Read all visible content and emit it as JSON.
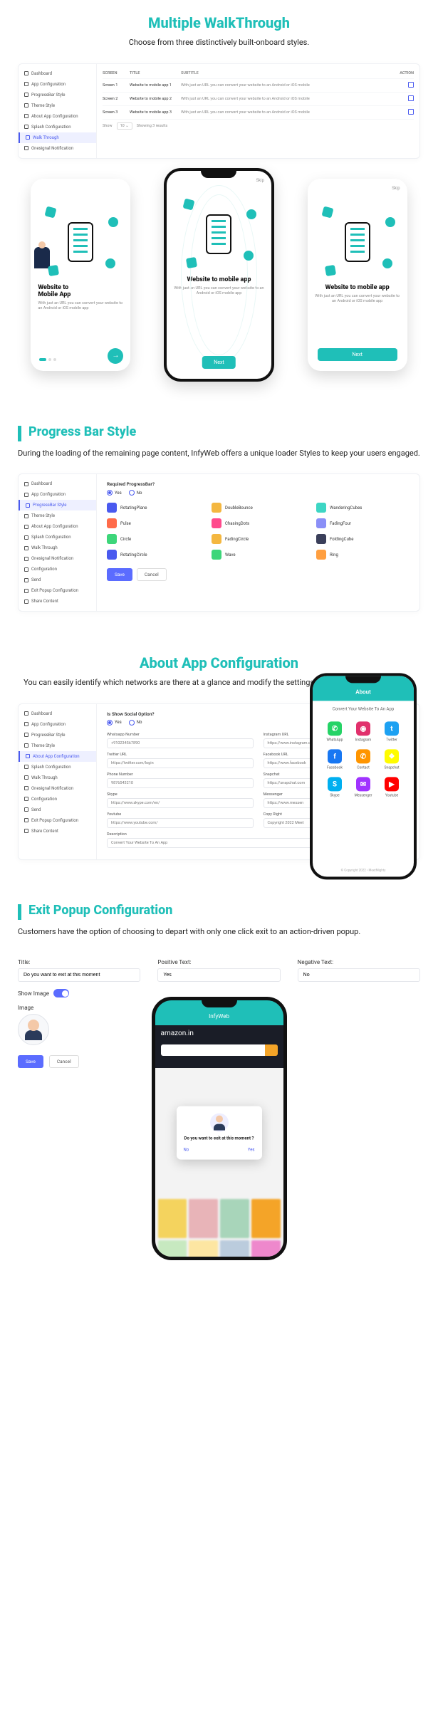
{
  "s1": {
    "title": "Multiple WalkThrough",
    "subtitle": "Choose from three distinctively built-onboard styles.",
    "sidebar": [
      "Dashboard",
      "App Configuration",
      "ProgressBar Style",
      "Theme Style",
      "About App Configuration",
      "Splash Configuration",
      "Walk Through",
      "Onesignal Notification"
    ],
    "activeIdx": 6,
    "thead": {
      "screen": "SCREEN",
      "title": "TITLE",
      "subtitle": "SUBTITLE",
      "action": "ACTION"
    },
    "rows": [
      {
        "screen": "Screen 1",
        "title": "Website to mobile app 1",
        "sub": "With just an URL you can convert your website to an Android or iOS mobile"
      },
      {
        "screen": "Screen 2",
        "title": "Website to mobile app 2",
        "sub": "With just an URL you can convert your website to an Android or iOS mobile"
      },
      {
        "screen": "Screen 3",
        "title": "Website to mobile app 3",
        "sub": "With just an URL you can convert your website to an Android or iOS mobile"
      }
    ],
    "pager": {
      "show": "Show",
      "n": "10",
      "summary": "Showing 3 results"
    },
    "phones": {
      "p1": {
        "title": "Website to\nMobile App",
        "desc": "With just an URL you can convert your website to an Android or iOS mobile app",
        "skip": ""
      },
      "p2": {
        "title": "Website to mobile app",
        "desc": "With just an URL you can convert your website to an Android or iOS mobile app",
        "next": "Next",
        "skip": "Skip"
      },
      "p3": {
        "title": "Website to mobile app",
        "desc": "With just an URL you can convert your website to an Android or iOS mobile app",
        "next": "Next",
        "skip": "Skip"
      }
    }
  },
  "s2": {
    "title": "Progress Bar Style",
    "subtitle": "During the loading of the remaining page content, InfyWeb offers a unique loader Styles to keep your users engaged.",
    "sidebar": [
      "Dashboard",
      "App Configuration",
      "ProgressBar Style",
      "Theme Style",
      "About App Configuration",
      "Splash Configuration",
      "Walk Through",
      "Onesignal Notification",
      "Configuration",
      "Send",
      "Exit Popup Configuration",
      "Share Content"
    ],
    "activeIdx": 2,
    "required": "Required ProgressBar?",
    "yes": "Yes",
    "no": "No",
    "loaders": [
      {
        "name": "RotatingPlane",
        "c": "#4a5aef"
      },
      {
        "name": "DoubleBounce",
        "c": "#f4b740"
      },
      {
        "name": "WanderingCubes",
        "c": "#3dd6c4"
      },
      {
        "name": "Pulse",
        "c": "#ff6b4a"
      },
      {
        "name": "ChasingDots",
        "c": "#ff4a8d"
      },
      {
        "name": "FadingFour",
        "c": "#8a8ff7"
      },
      {
        "name": "Circle",
        "c": "#3dd67a"
      },
      {
        "name": "FadingCircle",
        "c": "#f4b740"
      },
      {
        "name": "FoldingCube",
        "c": "#3a3f5a"
      },
      {
        "name": "RotatingCircle",
        "c": "#4a5aef"
      },
      {
        "name": "Wave",
        "c": "#3dd67a"
      },
      {
        "name": "Ring",
        "c": "#ff9f40"
      }
    ],
    "save": "Save",
    "cancel": "Cancel"
  },
  "s3": {
    "title": "About App Configuration",
    "subtitle": "You can easily identify which networks are there at a glance and modify the settings for each social network app.",
    "sidebar": [
      "Dashboard",
      "App Configuration",
      "ProgressBar Style",
      "Theme Style",
      "About App Configuration",
      "Splash Configuration",
      "Walk Through",
      "Onesignal Notification",
      "Configuration",
      "Send",
      "Exit Popup Configuration",
      "Share Content"
    ],
    "activeIdx": 4,
    "showSocial": "Is Show Social Option?",
    "yes": "Yes",
    "no": "No",
    "fields": {
      "whatsapp": {
        "label": "Whatsapp Number",
        "val": "+910234567890"
      },
      "instagram": {
        "label": "Instagram URL",
        "val": "https://www.instagram.com"
      },
      "twitter": {
        "label": "Twitter URL",
        "val": "https://twitter.com/login"
      },
      "facebook": {
        "label": "Facebook URL",
        "val": "https://www.facebook"
      },
      "phone": {
        "label": "Phone Number",
        "val": "9876543210"
      },
      "snapchat": {
        "label": "Snapchat",
        "val": "https://snapchat.com"
      },
      "skype": {
        "label": "Skype",
        "val": "https://www.skype.com/en/"
      },
      "messenger": {
        "label": "Messenger",
        "val": "https://www.messen"
      },
      "youtube": {
        "label": "Youtube",
        "val": "https://www.youtube.com/"
      },
      "copyright": {
        "label": "Copy Right",
        "val": "Copyright 2022 Meet"
      },
      "desc": {
        "label": "Description",
        "val": "Convert Your Website To An App"
      }
    },
    "about": {
      "hdr": "About",
      "sub": "Convert Your Website To An App",
      "copy": "© Copyright 2022 • MeetMighty"
    },
    "socials": [
      {
        "n": "WhatsApp",
        "c": "#25D366",
        "g": "✆"
      },
      {
        "n": "Instagram",
        "c": "#E1306C",
        "g": "◉"
      },
      {
        "n": "Twitter",
        "c": "#1DA1F2",
        "g": "t"
      },
      {
        "n": "Facebook",
        "c": "#1877F2",
        "g": "f"
      },
      {
        "n": "Contact",
        "c": "#FF9500",
        "g": "✆"
      },
      {
        "n": "Snapchat",
        "c": "#FFFC00",
        "g": "❖"
      },
      {
        "n": "Skype",
        "c": "#00AFF0",
        "g": "S"
      },
      {
        "n": "Messenger",
        "c": "#A033FF",
        "g": "✉"
      },
      {
        "n": "Youtube",
        "c": "#FF0000",
        "g": "▶"
      }
    ]
  },
  "s4": {
    "title": "Exit Popup Configuration",
    "subtitle": "Customers have the option of choosing to depart with only one click exit to an action-driven popup.",
    "titleLbl": "Title:",
    "titleVal": "Do you want to exit at this moment",
    "posLbl": "Positive Text:",
    "posVal": "Yes",
    "negLbl": "Negative Text:",
    "negVal": "No",
    "showImg": "Show Image",
    "img": "Image",
    "save": "Save",
    "cancel": "Cancel",
    "phone": {
      "hdr": "InfyWeb",
      "amazon": "amazon.in",
      "q": "Do you want to exit at this moment ?",
      "no": "No",
      "yes": "Yes"
    }
  }
}
